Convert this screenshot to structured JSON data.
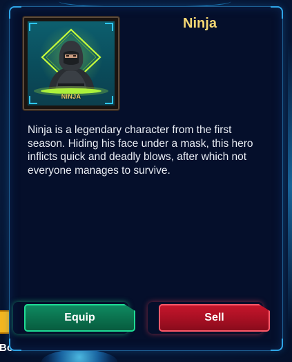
{
  "hero": {
    "title": "Ninja",
    "card_label": "NINJA",
    "description": "Ninja is a legendary character from the first season. Hiding his face under a mask, this hero inflicts quick and deadly blows, after which not everyone manages to survive."
  },
  "actions": {
    "equip_label": "Equip",
    "sell_label": "Sell"
  },
  "background": {
    "partial_label": "Bo"
  },
  "colors": {
    "title_gold": "#f6d873",
    "equip_green": "#0a6d4b",
    "sell_red": "#a30f22",
    "panel_border": "#1e5f92"
  },
  "icons": {
    "portrait_frame": "neon-diamond-frame",
    "background_item": "chest-icon"
  }
}
